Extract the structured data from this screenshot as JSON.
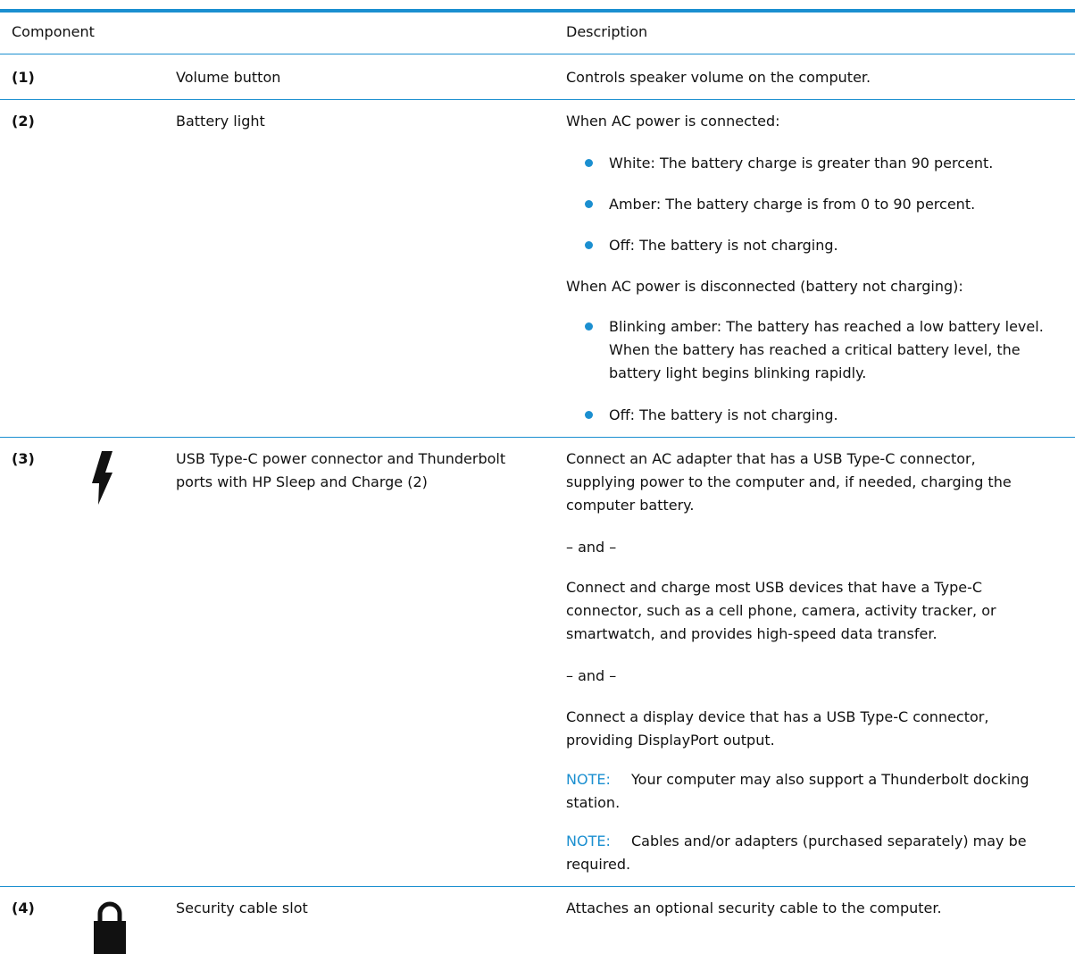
{
  "header": {
    "component": "Component",
    "description": "Description"
  },
  "rows": [
    {
      "number": "(1)",
      "name": "Volume button",
      "desc": "Controls speaker volume on the computer."
    },
    {
      "number": "(2)",
      "name": "Battery light",
      "intro_connected": "When AC power is connected:",
      "connected_bullets": [
        "White: The battery charge is greater than 90 percent.",
        "Amber: The battery charge is from 0 to 90 percent.",
        "Off: The battery is not charging."
      ],
      "intro_disconnected": "When AC power is disconnected (battery not charging):",
      "disconnected_bullets": [
        [
          "Blinking amber: The battery has reached a low battery level.",
          "When the battery has reached a critical battery level, the",
          "battery light begins blinking rapidly."
        ],
        [
          "Off: The battery is not charging."
        ]
      ]
    },
    {
      "number": "(3)",
      "icon": "lightning-bolt-icon",
      "name_lines": [
        "USB Type-C power connector and Thunderbolt",
        "ports with HP Sleep and Charge (2)"
      ],
      "para1": [
        "Connect an AC adapter that has a USB Type-C connector,",
        "supplying power to the computer and, if needed, charging the",
        "computer battery."
      ],
      "and1": "– and –",
      "para2": [
        "Connect and charge most USB devices that have a Type-C",
        "connector, such as a cell phone, camera, activity tracker, or",
        "smartwatch, and provides high-speed data transfer."
      ],
      "and2": "– and –",
      "para3": [
        "Connect a display device that has a USB Type-C connector,",
        "providing DisplayPort output."
      ],
      "note1": {
        "label": "NOTE:",
        "lines": [
          "Your computer may also support a Thunderbolt docking",
          "station."
        ]
      },
      "note2": {
        "label": "NOTE:",
        "lines": [
          "Cables and/or adapters (purchased separately) may be",
          "required."
        ]
      }
    },
    {
      "number": "(4)",
      "icon": "padlock-icon",
      "name": "Security cable slot",
      "desc": "Attaches an optional security cable to the computer."
    }
  ],
  "colors": {
    "accent": "#1b8fd0"
  }
}
